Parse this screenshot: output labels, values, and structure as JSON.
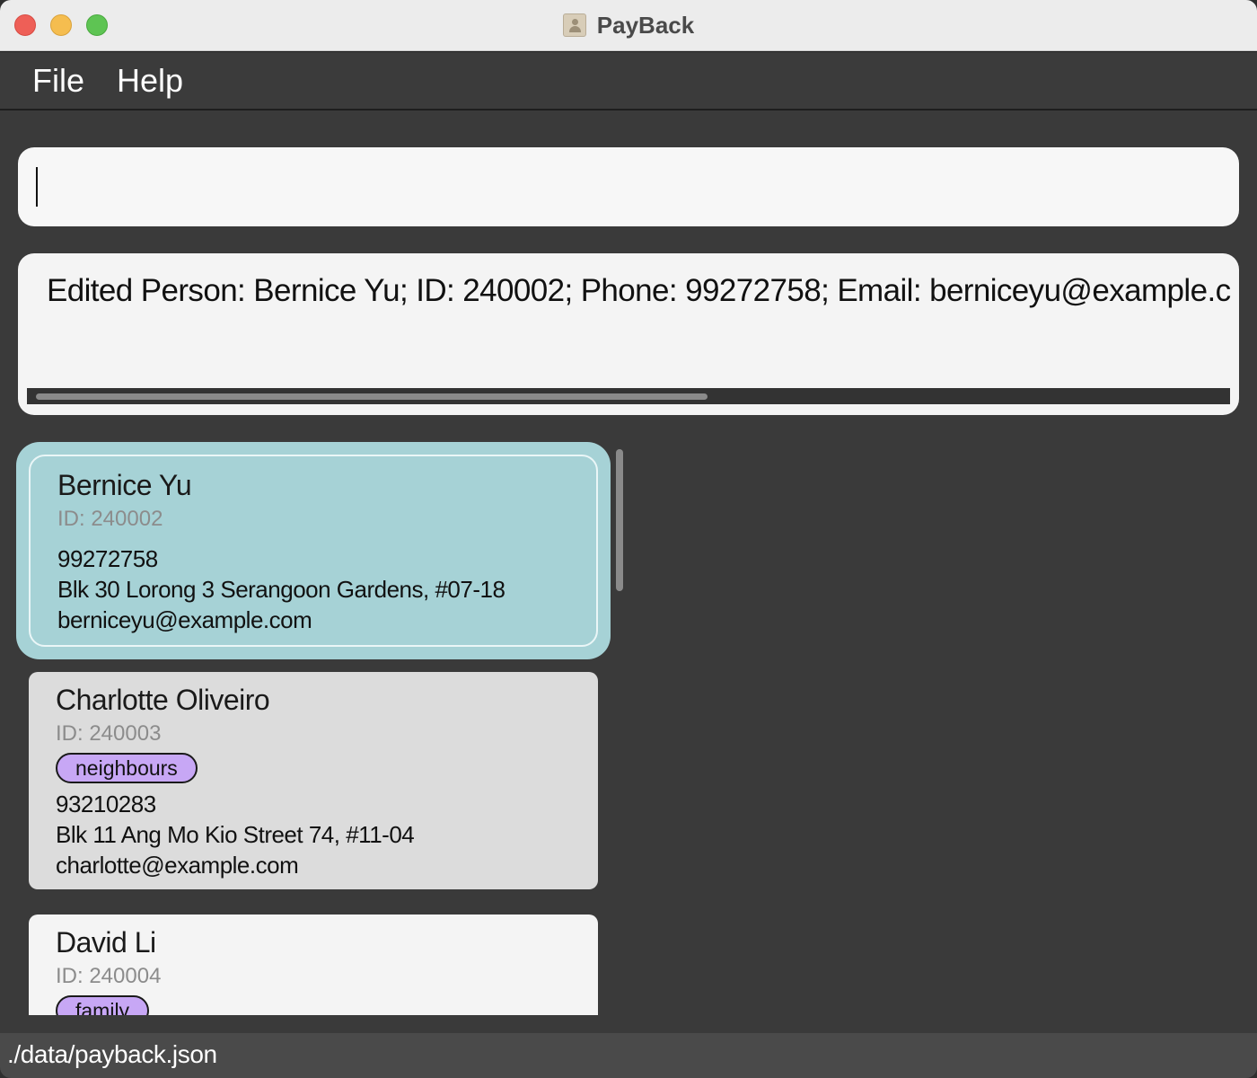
{
  "window": {
    "title": "PayBack"
  },
  "menu": {
    "items": [
      "File",
      "Help"
    ]
  },
  "command": {
    "value": "",
    "placeholder": ""
  },
  "result": {
    "text": "Edited Person: Bernice Yu; ID: 240002; Phone: 99272758; Email: berniceyu@example.c"
  },
  "persons": [
    {
      "name": "Bernice Yu",
      "id": "ID: 240002",
      "tags": [],
      "phone": "99272758",
      "address": "Blk 30 Lorong 3 Serangoon Gardens, #07-18",
      "email": "berniceyu@example.com",
      "selected": true
    },
    {
      "name": "Charlotte Oliveiro",
      "id": "ID: 240003",
      "tags": [
        "neighbours"
      ],
      "phone": "93210283",
      "address": "Blk 11 Ang Mo Kio Street 74, #11-04",
      "email": "charlotte@example.com",
      "selected": false
    },
    {
      "name": "David Li",
      "id": "ID: 240004",
      "tags": [
        "family"
      ],
      "selected": false
    }
  ],
  "status": {
    "path": "./data/payback.json"
  },
  "colors": {
    "selected_card": "#a6d2d6",
    "tag_fill": "#c7a7f5",
    "window_bg": "#3a3a3a"
  }
}
